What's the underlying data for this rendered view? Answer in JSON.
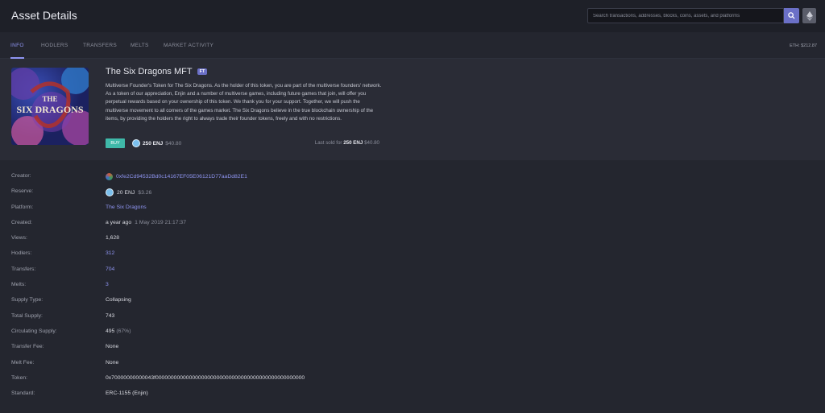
{
  "header": {
    "title": "Asset Details",
    "search_placeholder": "Search transactions, addresses, blocks, coins, assets, and platforms",
    "search_icon": "search-icon",
    "network_icon": "ethereum-icon"
  },
  "tabs": [
    {
      "label": "INFO",
      "active": true
    },
    {
      "label": "HODLERS",
      "active": false
    },
    {
      "label": "TRANSFERS",
      "active": false
    },
    {
      "label": "MELTS",
      "active": false
    },
    {
      "label": "MARKET ACTIVITY",
      "active": false
    }
  ],
  "eth_price": "ETH: $212.87",
  "asset": {
    "image_title": "THE SIX DRAGONS",
    "name": "The Six Dragons MFT",
    "badge": "FT",
    "description": "Multiverse Founder's Token for The Six Dragons. As the holder of this token, you are part of the multiverse founders' network. As a token of our appreciation, Enjin and a number of multiverse games, including future games that join, will offer you perpetual rewards based on your ownership of this token. We thank you for your support. Together, we will push the multiverse movement to all corners of the games market. The Six Dragons believe in the true blockchain ownership of the items, by providing the holders the right to always trade their founder tokens, freely and with no restrictions.",
    "buy_label": "BUY",
    "price_enj": "250 ENJ",
    "price_usd": "$40.80",
    "last_sold_prefix": "Last sold for",
    "last_sold_enj": "250 ENJ",
    "last_sold_usd": "$40.80"
  },
  "details": {
    "creator": {
      "label": "Creator:",
      "value": "0xfe2Cd94532Bd0c14167EF05E06121D77aaDd82E1"
    },
    "reserve": {
      "label": "Reserve:",
      "enj": "20 ENJ",
      "usd": "$3.26"
    },
    "platform": {
      "label": "Platform:",
      "value": "The Six Dragons"
    },
    "created": {
      "label": "Created:",
      "relative": "a year ago",
      "date": "1 May 2019 21:17:37"
    },
    "views": {
      "label": "Views:",
      "value": "1,628"
    },
    "hodlers": {
      "label": "Hodlers:",
      "value": "312"
    },
    "transfers": {
      "label": "Transfers:",
      "value": "704"
    },
    "melts": {
      "label": "Melts:",
      "value": "3"
    },
    "supply_type": {
      "label": "Supply Type:",
      "value": "Collapsing"
    },
    "total_supply": {
      "label": "Total Supply:",
      "value": "743"
    },
    "circulating_supply": {
      "label": "Circulating Supply:",
      "value": "495",
      "percent": "(67%)"
    },
    "transfer_fee": {
      "label": "Transfer Fee:",
      "value": "None"
    },
    "melt_fee": {
      "label": "Melt Fee:",
      "value": "None"
    },
    "token": {
      "label": "Token:",
      "value": "0x70000000000043f0000000000000000000000000000000000000000000000000"
    },
    "standard": {
      "label": "Standard:",
      "value": "ERC-1155 (Enjin)"
    }
  }
}
